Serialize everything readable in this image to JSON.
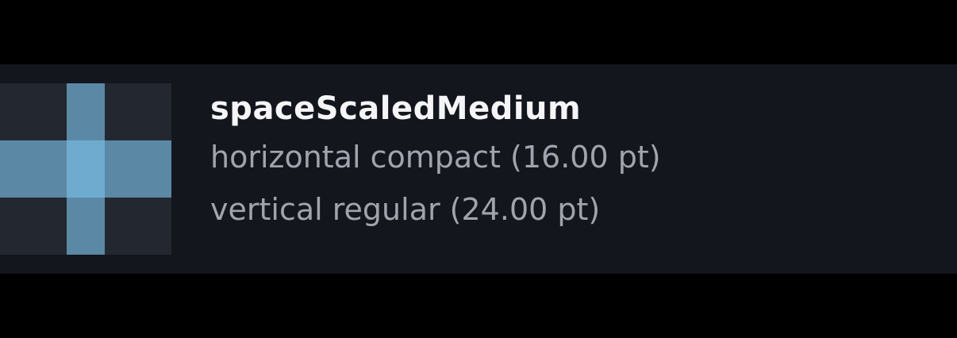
{
  "token": {
    "name": "spaceScaledMedium",
    "horizontal": "horizontal compact (16.00 pt)",
    "vertical": "vertical regular (24.00 pt)"
  },
  "colors": {
    "background": "#000000",
    "row_background": "#13161d",
    "swatch_background": "#232730",
    "swatch_bar": "#5b89a5",
    "swatch_center": "#6fabcf",
    "title_text": "#f5f5f7",
    "secondary_text": "#a0a4ad"
  }
}
